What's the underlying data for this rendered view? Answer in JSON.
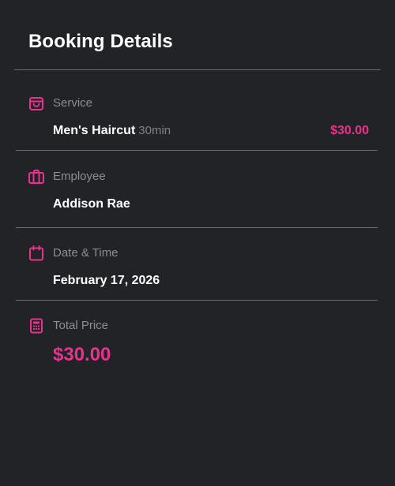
{
  "header": {
    "title": "Booking Details"
  },
  "service": {
    "label": "Service",
    "name": "Men's Haircut",
    "duration": "30min",
    "price": "$30.00",
    "icon": "shopping-bag-icon"
  },
  "employee": {
    "label": "Employee",
    "name": "Addison Rae",
    "icon": "briefcase-icon"
  },
  "datetime": {
    "label": "Date & Time",
    "value": "February 17, 2026",
    "icon": "calendar-icon"
  },
  "total": {
    "label": "Total Price",
    "value": "$30.00",
    "icon": "calculator-icon"
  },
  "colors": {
    "background": "#212327",
    "accent": "#e8328b",
    "label": "#8b8e94",
    "divider": "#6a6d73"
  }
}
